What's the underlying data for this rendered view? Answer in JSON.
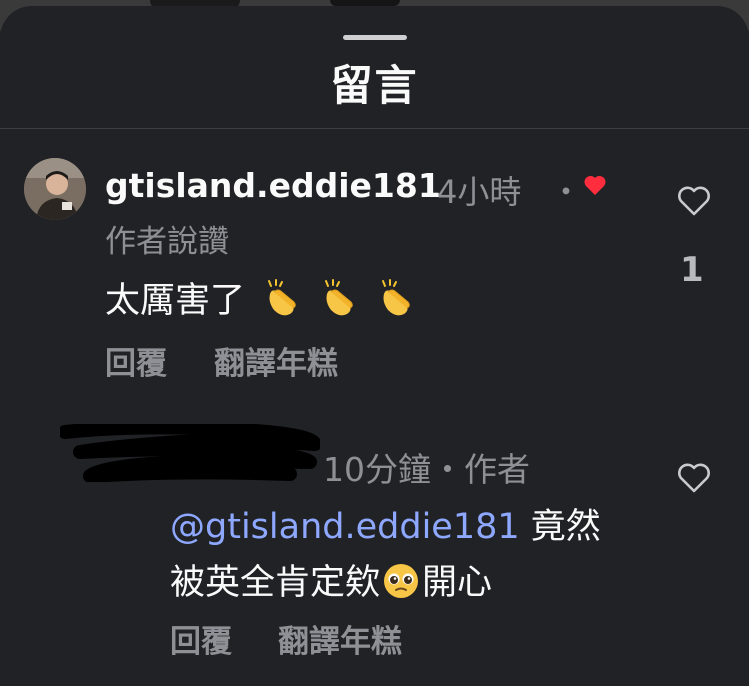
{
  "sheet": {
    "title": "留言"
  },
  "comment": {
    "username": "gtisland.eddie181",
    "time": "4小時",
    "dot": "・",
    "author_liked": "作者說讚",
    "text": "太厲害了",
    "emoji": "clapping-hands",
    "reply_label": "回覆",
    "translate_label": "翻譯年糕",
    "like_count": "1",
    "author_heart_color": "#ff2d3d"
  },
  "reply": {
    "username_redacted": true,
    "meta": "10分鐘・作者",
    "mention": "@gtisland.eddie181",
    "text_line1_rest": " 竟然",
    "text_line2_before": "被英全肯定欸",
    "emoji": "pleading-face",
    "text_line2_after": "開心",
    "reply_label": "回覆",
    "translate_label": "翻譯年糕"
  },
  "colors": {
    "background": "#202226",
    "secondary_text": "#8e9095",
    "mention": "#8fa8ff"
  }
}
